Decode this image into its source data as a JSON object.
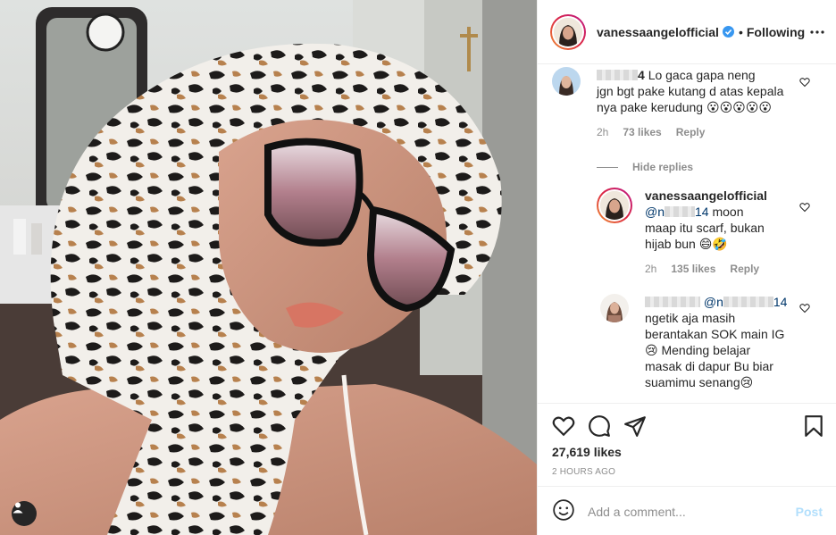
{
  "header": {
    "username": "vanessaangelofficial",
    "separator": "•",
    "follow_status": "Following"
  },
  "comments": [
    {
      "username": "",
      "username_visible_tail": "4",
      "lines": [
        "Lo gaca gapa neng",
        "jgn bgt pake kutang d atas kepala",
        "nya pake kerudung 😮😮😮😮😮"
      ],
      "time": "2h",
      "likes": "73 likes",
      "reply_label": "Reply"
    }
  ],
  "hide_replies": "Hide replies",
  "replies": [
    {
      "username": "vanessaangelofficial",
      "mention_prefix": "@n",
      "mention_tail": "14",
      "lines": [
        "moon",
        "maap itu scarf, bukan",
        "hijab bun 😄🤣"
      ],
      "time": "2h",
      "likes": "135 likes",
      "reply_label": "Reply"
    },
    {
      "mention_prefix": "@n",
      "mention_tail": "14",
      "lines": [
        "ngetik aja masih",
        "berantakan SOK main IG",
        "😢 Mending belajar",
        "masak di dapur Bu biar",
        "suamimu senang😢"
      ]
    }
  ],
  "actions": {
    "likes": "27,619 likes",
    "timestamp": "2 HOURS AGO",
    "comment_placeholder": "Add a comment...",
    "post_label": "Post"
  },
  "colors": {
    "accent": "#0095f6",
    "post_disabled": "#b2dffc",
    "meta": "#8e8e8e",
    "text": "#262626"
  },
  "icons": [
    "heart-icon",
    "comment-icon",
    "share-icon",
    "bookmark-icon",
    "emoji-icon",
    "more-icon",
    "verified-icon",
    "user-tag-icon"
  ]
}
